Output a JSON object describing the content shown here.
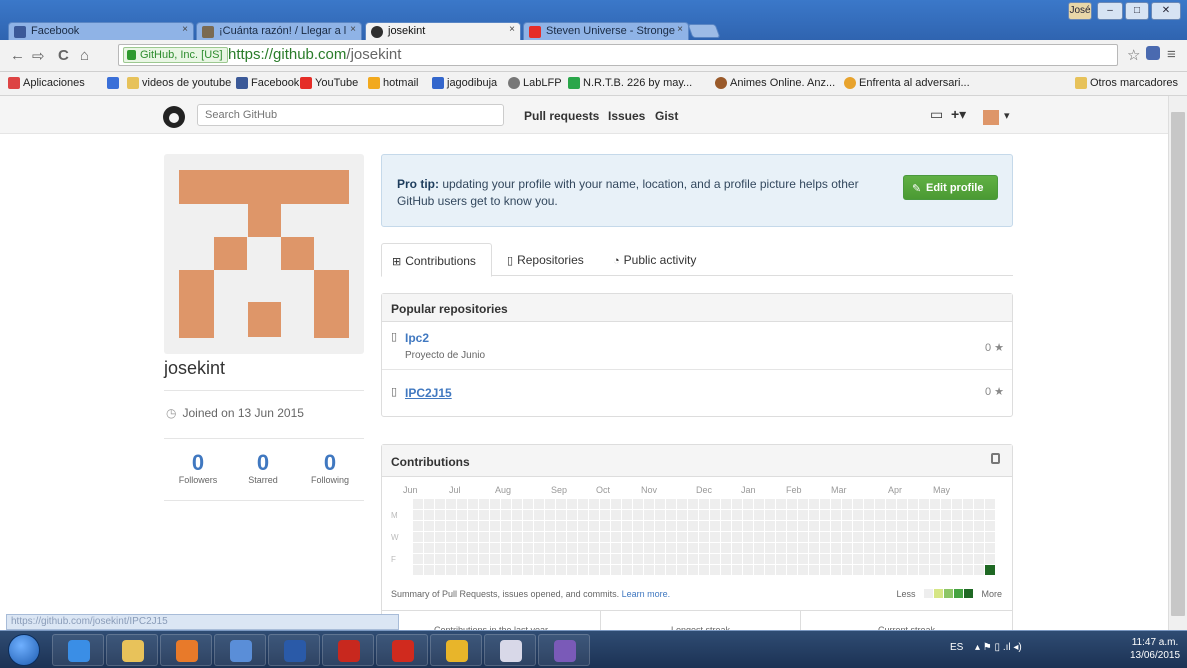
{
  "browser": {
    "tabs": [
      {
        "title": "Facebook",
        "icon_color": "#3b5998",
        "active": false
      },
      {
        "title": "¡Cuánta razón! / Llegar a l",
        "icon_color": "#7a6a52",
        "active": false
      },
      {
        "title": "josekint",
        "icon_color": "#2f2f2f",
        "active": true
      },
      {
        "title": "Steven Universe - Stronge",
        "icon_color": "#e52d27",
        "active": false
      }
    ],
    "tab_close": "×",
    "window_user": "José",
    "window_minimize": "–",
    "window_maximize": "□",
    "window_close": "✕",
    "ev_label": "GitHub, Inc. [US]",
    "url_scheme_host": "https://github.com",
    "url_path": "/josekint",
    "nav_back": "←",
    "nav_forward": "⇨",
    "nav_reload": "C",
    "nav_home": "⌂",
    "star": "☆",
    "menu": "≡"
  },
  "bookmarks": {
    "apps": "Aplicaciones",
    "items": [
      {
        "label": "",
        "color": "#3a6fd8"
      },
      {
        "label": "videos de youtube",
        "color": "#e7c25a"
      },
      {
        "label": "Facebook",
        "color": "#3b5998"
      },
      {
        "label": "YouTube",
        "color": "#e52d27"
      },
      {
        "label": "hotmail",
        "color": "#f2a91e"
      },
      {
        "label": "jagodibuja",
        "color": "#3366cc"
      },
      {
        "label": "LabLFP",
        "color": "#777777"
      },
      {
        "label": "N.R.T.B. 226 by may...",
        "color": "#2aa64a"
      },
      {
        "label": "Animes Online. Anz...",
        "color": "#9a5a2a"
      },
      {
        "label": "Enfrenta al adversari...",
        "color": "#e8a32d"
      }
    ],
    "other": "Otros marcadores"
  },
  "github_header": {
    "search_placeholder": "Search GitHub",
    "nav": [
      "Pull requests",
      "Issues",
      "Gist"
    ],
    "inbox_icon": "▭",
    "plus": "+▾",
    "avatar_caret": "▾"
  },
  "profile": {
    "username": "josekint",
    "joined": "Joined on 13 Jun 2015",
    "clock_icon": "◷",
    "followers": {
      "count": "0",
      "label": "Followers"
    },
    "starred": {
      "count": "0",
      "label": "Starred"
    },
    "following": {
      "count": "0",
      "label": "Following"
    },
    "avatar_color": "#de9669"
  },
  "protip": {
    "lead": "Pro tip:",
    "text": " updating your profile with your name, location, and a profile picture helps other GitHub users get to know you.",
    "button": "Edit profile",
    "pencil": "✎"
  },
  "tabs": {
    "contributions": "Contributions",
    "repositories": "Repositories",
    "public_activity": "Public activity",
    "contributions_icon": "⊞",
    "repositories_icon": "▯",
    "activity_icon": "◔"
  },
  "popular_repos": {
    "title": "Popular repositories",
    "repos": [
      {
        "name": "Ipc2",
        "description": "Proyecto de Junio",
        "stars": "0 ★"
      },
      {
        "name": "IPC2J15",
        "description": "",
        "stars": "0 ★"
      }
    ],
    "repo_icon": "▯"
  },
  "contributions": {
    "title": "Contributions",
    "lock_icon": "🔒",
    "months": [
      "Jun",
      "Jul",
      "Aug",
      "Sep",
      "Oct",
      "Nov",
      "Dec",
      "Jan",
      "Feb",
      "Mar",
      "Apr",
      "May"
    ],
    "days": [
      "M",
      "W",
      "F"
    ],
    "weeks": 53,
    "active_cell": {
      "week": 52,
      "day": 6,
      "color": "#1e6823"
    },
    "empty_color": "#eeeeee",
    "summary_text": "Summary of Pull Requests, issues opened, and commits.",
    "learn_more": "Learn more.",
    "less": "Less",
    "more": "More",
    "legend_colors": [
      "#eeeeee",
      "#d6e685",
      "#8cc665",
      "#44a340",
      "#1e6823"
    ],
    "footer": [
      "Contributions in the last year",
      "Longest streak",
      "Current streak"
    ]
  },
  "status_bubble": "https://github.com/josekint/IPC2J15",
  "taskbar": {
    "apps": [
      {
        "name": "ie",
        "color": "#3a8ee6"
      },
      {
        "name": "explorer",
        "color": "#e8c25a"
      },
      {
        "name": "media",
        "color": "#e87a2a"
      },
      {
        "name": "virtualbox",
        "color": "#5a8ed8"
      },
      {
        "name": "word",
        "color": "#2a5aa8"
      },
      {
        "name": "app-red",
        "color": "#c8281e"
      },
      {
        "name": "acrobat",
        "color": "#d02a1e"
      },
      {
        "name": "chrome",
        "color": "#e8b52a"
      },
      {
        "name": "snipping",
        "color": "#d8d8e8"
      },
      {
        "name": "github",
        "color": "#7a5ab8"
      }
    ],
    "lang": "ES",
    "time": "11:47 a.m.",
    "date": "13/06/2015",
    "tray_icons": "▴  ⚑  ▯  .ıl  ◂)"
  }
}
